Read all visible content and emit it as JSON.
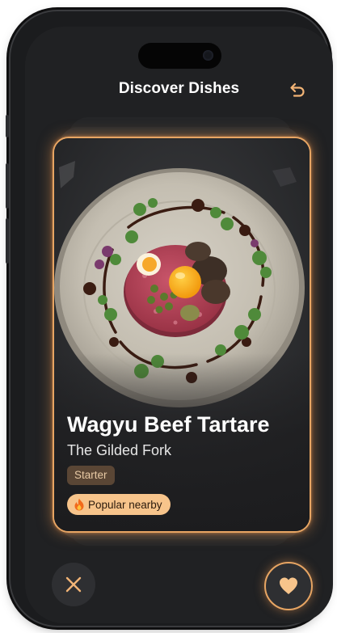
{
  "header": {
    "title": "Discover Dishes",
    "undo_icon": "undo-icon"
  },
  "card": {
    "dish_name": "Wagyu Beef Tartare",
    "restaurant": "The Gilded Fork",
    "category": "Starter",
    "badge_icon": "fire-icon",
    "badge_label": "Popular nearby",
    "photo": "beef-tartare-photo"
  },
  "actions": {
    "dislike_icon": "close-icon",
    "like_icon": "heart-icon"
  },
  "colors": {
    "accent": "#e7a563",
    "badge_bg": "#f7c48b",
    "tag_bg": "#5a4635",
    "screen_bg": "#202123"
  }
}
